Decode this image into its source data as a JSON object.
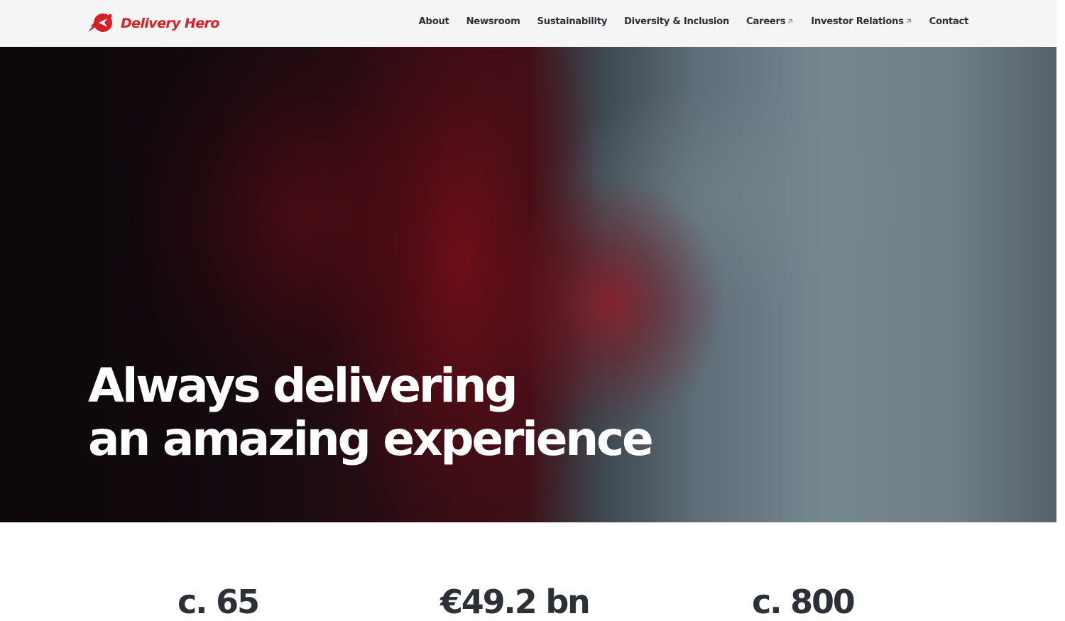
{
  "brand": {
    "name": "Delivery Hero",
    "logo_icon": "delivery-hero-mascot-icon",
    "color": "#d61f26"
  },
  "nav": {
    "about": "About",
    "newsroom": "Newsroom",
    "sustainability": "Sustainability",
    "diversity": "Diversity & Inclusion",
    "careers": "Careers",
    "investor_relations": "Investor Relations",
    "contact": "Contact",
    "external_icon": "external-link-arrow-icon"
  },
  "hero": {
    "line1": "Always delivering",
    "line2": "an amazing experience"
  },
  "stats": {
    "countries": "c. 65",
    "gmv": "€49.2 bn",
    "value3": "c. 800"
  }
}
